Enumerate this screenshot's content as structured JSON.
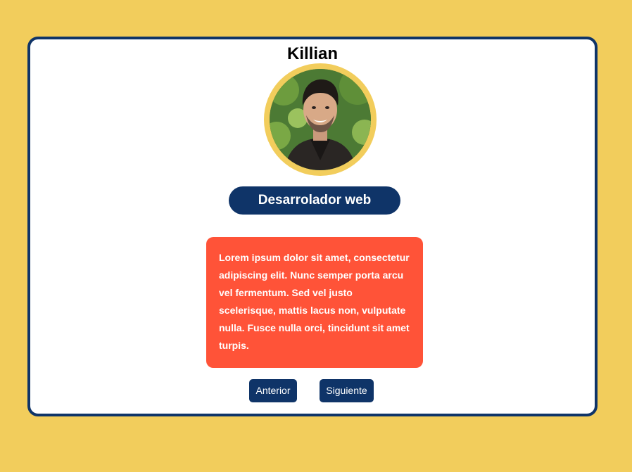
{
  "card": {
    "name": "Killian",
    "role": "Desarrolador web",
    "bio": "Lorem ipsum dolor sit amet, consectetur adipiscing elit. Nunc semper porta arcu vel fermentum. Sed vel justo scelerisque, mattis lacus non, vulputate nulla. Fusce nulla orci, tincidunt sit amet turpis."
  },
  "buttons": {
    "prev_label": "Anterior",
    "next_label": "Siguiente"
  },
  "colors": {
    "background": "#f2cd5c",
    "navy": "#0f3468",
    "bio_bg": "#ff5338",
    "card_bg": "#ffffff"
  }
}
